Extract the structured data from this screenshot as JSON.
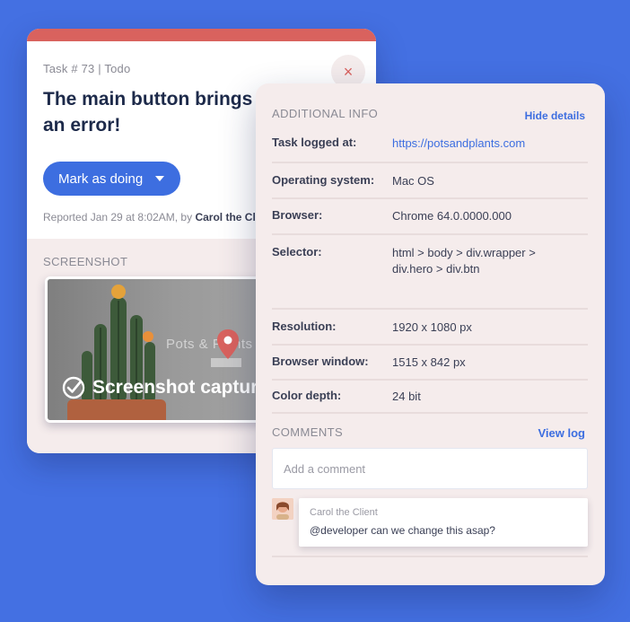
{
  "task": {
    "meta": "Task # 73 | Todo",
    "title": "The main button brings up an error!",
    "close_icon": "×",
    "mark_button": "Mark as doing",
    "reported_prefix": "Reported Jan 29 at 8:02AM, by ",
    "reported_by": "Carol the Client",
    "screenshot_label": "SCREENSHOT",
    "screenshot_brand": "Pots & Plants",
    "screenshot_status": "Screenshot captured"
  },
  "info": {
    "heading": "ADDITIONAL INFO",
    "hide_link": "Hide details",
    "rows": [
      {
        "label": "Task logged at:",
        "value": "https://potsandplants.com"
      },
      {
        "label": "Operating system:",
        "value": "Mac OS"
      },
      {
        "label": "Browser:",
        "value": "Chrome 64.0.0000.000"
      },
      {
        "label": "Selector:",
        "value": "html > body > div.wrapper > div.hero > div.btn"
      },
      {
        "label": "Resolution:",
        "value": "1920 x 1080 px"
      },
      {
        "label": "Browser window:",
        "value": "1515 x 842 px"
      },
      {
        "label": "Color depth:",
        "value": "24 bit"
      }
    ]
  },
  "comments": {
    "heading": "COMMENTS",
    "view_log": "View log",
    "placeholder": "Add a comment",
    "items": [
      {
        "author": "Carol the Client",
        "text": "@developer can we change this asap?"
      }
    ]
  },
  "colors": {
    "background": "#4470e2",
    "accent": "#3d6ee0",
    "top_bar": "#d9625e"
  }
}
